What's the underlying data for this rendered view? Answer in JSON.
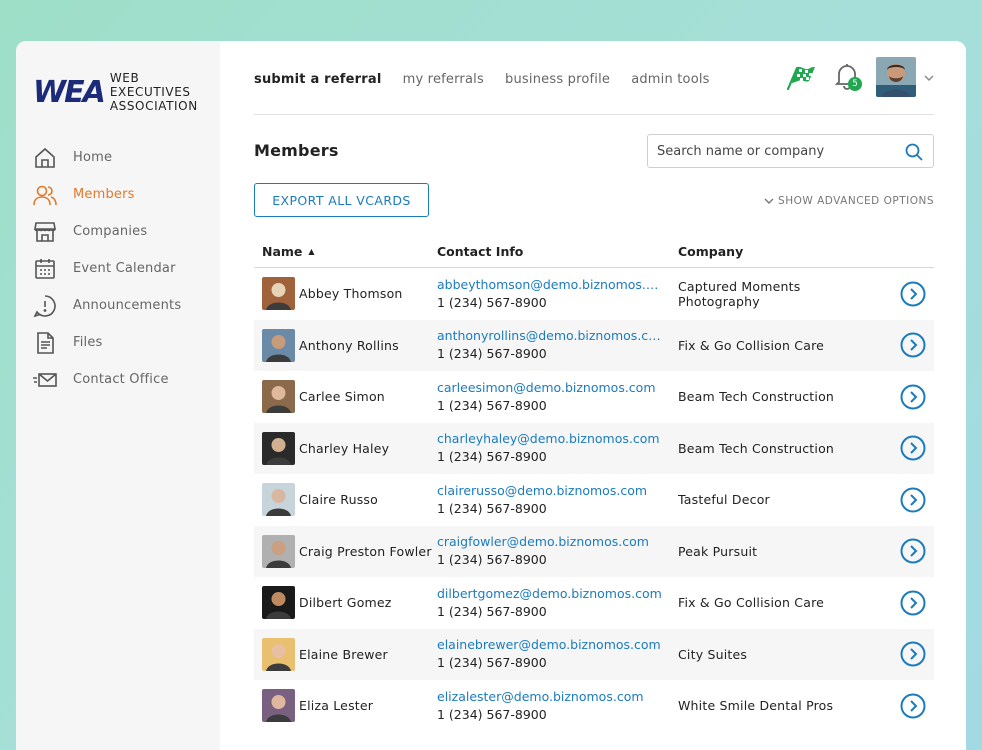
{
  "logo": {
    "mark": "WEA",
    "line1": "WEB EXECUTIVES",
    "line2": "ASSOCIATION"
  },
  "sidebar": {
    "items": [
      {
        "label": "Home",
        "icon": "home-icon"
      },
      {
        "label": "Members",
        "icon": "members-icon",
        "active": true
      },
      {
        "label": "Companies",
        "icon": "store-icon"
      },
      {
        "label": "Event Calendar",
        "icon": "calendar-icon"
      },
      {
        "label": "Announcements",
        "icon": "announcement-icon"
      },
      {
        "label": "Files",
        "icon": "file-icon"
      },
      {
        "label": "Contact Office",
        "icon": "mail-icon"
      }
    ]
  },
  "topnav": {
    "submit": "submit a referral",
    "referrals": "my referrals",
    "profile": "business profile",
    "admin": "admin tools"
  },
  "notifications": {
    "count": "5"
  },
  "page": {
    "title": "Members",
    "search_placeholder": "Search name or company",
    "export_label": "EXPORT ALL VCARDS",
    "advanced_label": "SHOW ADVANCED OPTIONS"
  },
  "table": {
    "headers": {
      "name": "Name",
      "contact": "Contact Info",
      "company": "Company"
    },
    "rows": [
      {
        "name": "Abbey Thomson",
        "email": "abbeythomson@demo.biznomos.com",
        "phone": "1 (234) 567-8900",
        "company": "Captured Moments Photography"
      },
      {
        "name": "Anthony Rollins",
        "email": "anthonyrollins@demo.biznomos.com",
        "phone": "1 (234) 567-8900",
        "company": "Fix & Go Collision Care"
      },
      {
        "name": "Carlee Simon",
        "email": "carleesimon@demo.biznomos.com",
        "phone": "1 (234) 567-8900",
        "company": "Beam Tech Construction"
      },
      {
        "name": "Charley Haley",
        "email": "charleyhaley@demo.biznomos.com",
        "phone": "1 (234) 567-8900",
        "company": "Beam Tech Construction"
      },
      {
        "name": "Claire Russo",
        "email": "clairerusso@demo.biznomos.com",
        "phone": "1 (234) 567-8900",
        "company": "Tasteful Decor"
      },
      {
        "name": "Craig Preston Fowler",
        "email": "craigfowler@demo.biznomos.com",
        "phone": "1 (234) 567-8900",
        "company": "Peak Pursuit"
      },
      {
        "name": "Dilbert Gomez",
        "email": "dilbertgomez@demo.biznomos.com",
        "phone": "1 (234) 567-8900",
        "company": "Fix & Go Collision Care"
      },
      {
        "name": "Elaine Brewer",
        "email": "elainebrewer@demo.biznomos.com",
        "phone": "1 (234) 567-8900",
        "company": "City Suites"
      },
      {
        "name": "Eliza Lester",
        "email": "elizalester@demo.biznomos.com",
        "phone": "1 (234) 567-8900",
        "company": "White Smile Dental Pros"
      }
    ]
  },
  "colors": {
    "accent": "#1b7bbf",
    "active": "#e07a2c",
    "brand": "#1c2a7a",
    "badge": "#1fa84f"
  }
}
